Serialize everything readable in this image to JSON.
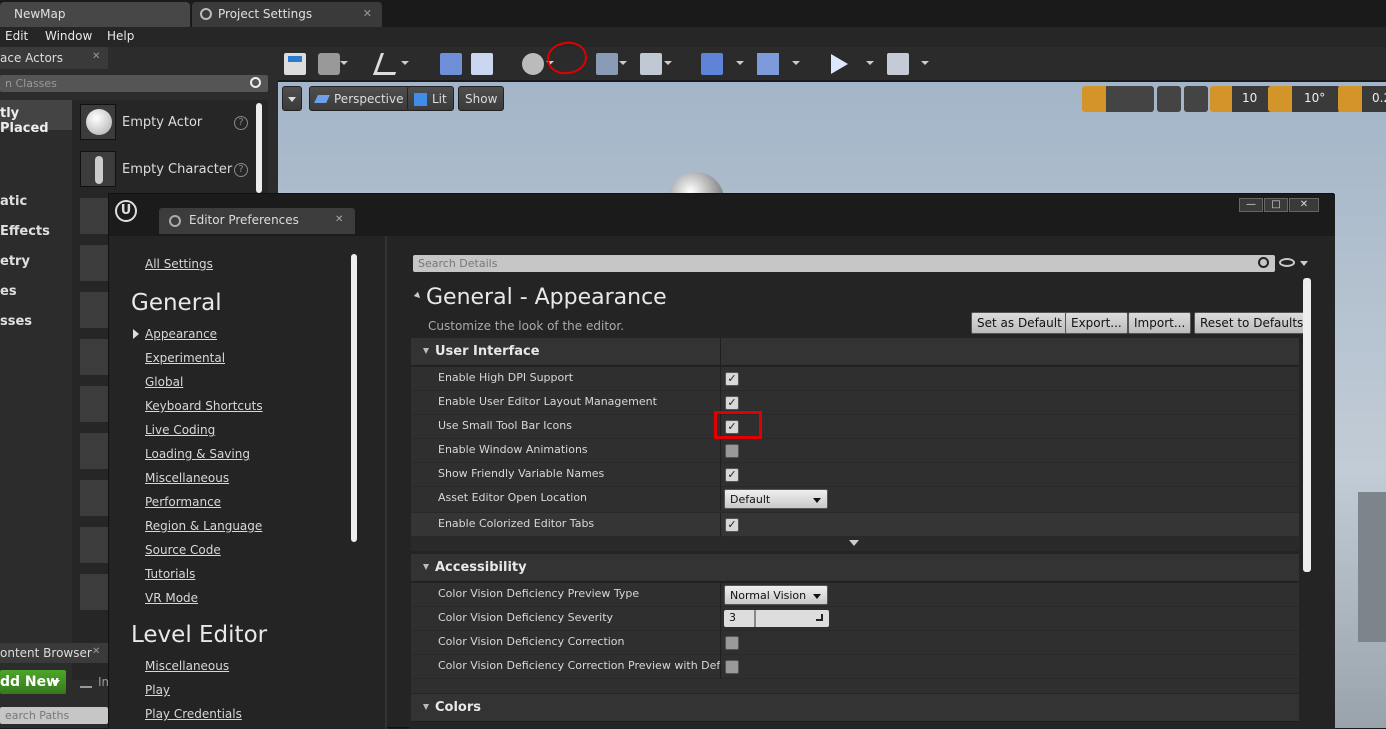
{
  "tabs": [
    {
      "label": "NewMap"
    },
    {
      "label": "Project Settings"
    }
  ],
  "menu": [
    "Edit",
    "Window",
    "Help"
  ],
  "place_actors": {
    "tab_label": "ace Actors",
    "search_placeholder": "n Classes",
    "categories": [
      "tly Placed",
      "atic",
      "Effects",
      "etry",
      "es",
      "sses"
    ],
    "items": [
      {
        "label": "Empty Actor"
      },
      {
        "label": "Empty Character"
      }
    ]
  },
  "content_browser": {
    "tab_label": "ontent Browser",
    "add_new_label": "dd New",
    "import_label": "Im",
    "search_placeholder": "earch Paths"
  },
  "viewport": {
    "perspective_label": "Perspective",
    "lit_label": "Lit",
    "show_label": "Show",
    "grid_snap": "10",
    "rotation_snap": "10°",
    "scale_snap": "0.2"
  },
  "prefs_window": {
    "tab_label": "Editor Preferences",
    "nav": {
      "all_settings": "All Settings",
      "general_heading": "General",
      "general_items": [
        "Appearance",
        "Experimental",
        "Global",
        "Keyboard Shortcuts",
        "Live Coding",
        "Loading & Saving",
        "Miscellaneous",
        "Performance",
        "Region & Language",
        "Source Code",
        "Tutorials",
        "VR Mode"
      ],
      "level_editor_heading": "Level Editor",
      "level_editor_items": [
        "Miscellaneous",
        "Play",
        "Play Credentials"
      ]
    },
    "details": {
      "search_placeholder": "Search Details",
      "title": "General - Appearance",
      "description": "Customize the look of the editor.",
      "buttons": {
        "set_default": "Set as Default",
        "export": "Export...",
        "import": "Import...",
        "reset": "Reset to Defaults"
      },
      "user_interface": {
        "heading": "User Interface",
        "rows": [
          {
            "label": "Enable High DPI Support",
            "checked": true
          },
          {
            "label": "Enable User Editor Layout Management",
            "checked": true
          },
          {
            "label": "Use Small Tool Bar Icons",
            "checked": true
          },
          {
            "label": "Enable Window Animations",
            "checked": false
          },
          {
            "label": "Show Friendly Variable Names",
            "checked": true
          },
          {
            "label": "Asset Editor Open Location",
            "value": "Default"
          },
          {
            "label": "Enable Colorized Editor Tabs",
            "checked": true
          }
        ]
      },
      "accessibility": {
        "heading": "Accessibility",
        "rows": [
          {
            "label": "Color Vision Deficiency Preview Type",
            "value": "Normal Vision"
          },
          {
            "label": "Color Vision Deficiency Severity",
            "value": "3"
          },
          {
            "label": "Color Vision Deficiency Correction",
            "checked": false
          },
          {
            "label": "Color Vision Deficiency Correction Preview with Deficiency",
            "checked": false
          }
        ]
      },
      "colors": {
        "heading": "Colors"
      }
    }
  },
  "annotation_colors": {
    "highlight": "#e00000"
  }
}
